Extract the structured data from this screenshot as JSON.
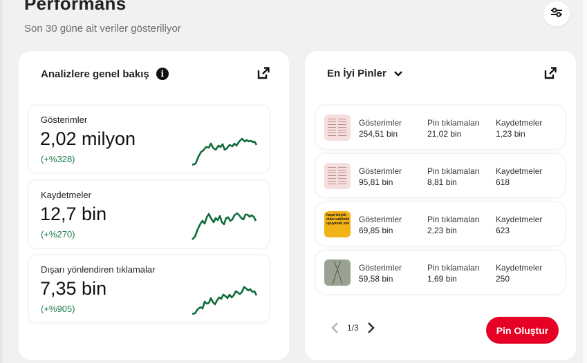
{
  "page": {
    "title": "Performans",
    "subtitle": "Son 30 güne ait veriler gösteriliyor"
  },
  "overview": {
    "title": "Analizlere genel bakış",
    "metrics": [
      {
        "label": "Gösterimler",
        "value": "2,02 milyon",
        "change": "(+%328)"
      },
      {
        "label": "Kaydetmeler",
        "value": "12,7 bin",
        "change": "(+%270)"
      },
      {
        "label": "Dışarı yönlendiren tıklamalar",
        "value": "7,35 bin",
        "change": "(+%905)"
      }
    ]
  },
  "top_pins": {
    "title": "En İyi Pinler",
    "column_labels": {
      "impressions": "Gösterimler",
      "clicks": "Pin tıklamaları",
      "saves": "Kaydetmeler"
    },
    "rows": [
      {
        "impressions": "254,51 bin",
        "clicks": "21,02 bin",
        "saves": "1,23 bin"
      },
      {
        "impressions": "95,81 bin",
        "clicks": "8,81 bin",
        "saves": "618"
      },
      {
        "impressions": "69,85 bin",
        "clicks": "2,23 bin",
        "saves": "623"
      },
      {
        "impressions": "59,58 bin",
        "clicks": "1,69 bin",
        "saves": "250"
      }
    ],
    "pin3_thumbnail_text": "hayal büyük olanı vaktinde uyuyanak yok",
    "pagination": "1/3",
    "create_button": "Pin Oluştur"
  },
  "colors": {
    "accent": "#e60023",
    "positive": "#1c7a4a",
    "sparkline": "#0f6b3a"
  },
  "icons": [
    "filter-icon",
    "info-icon",
    "external-link-icon",
    "chevron-down-icon",
    "chevron-left-icon",
    "chevron-right-icon"
  ]
}
